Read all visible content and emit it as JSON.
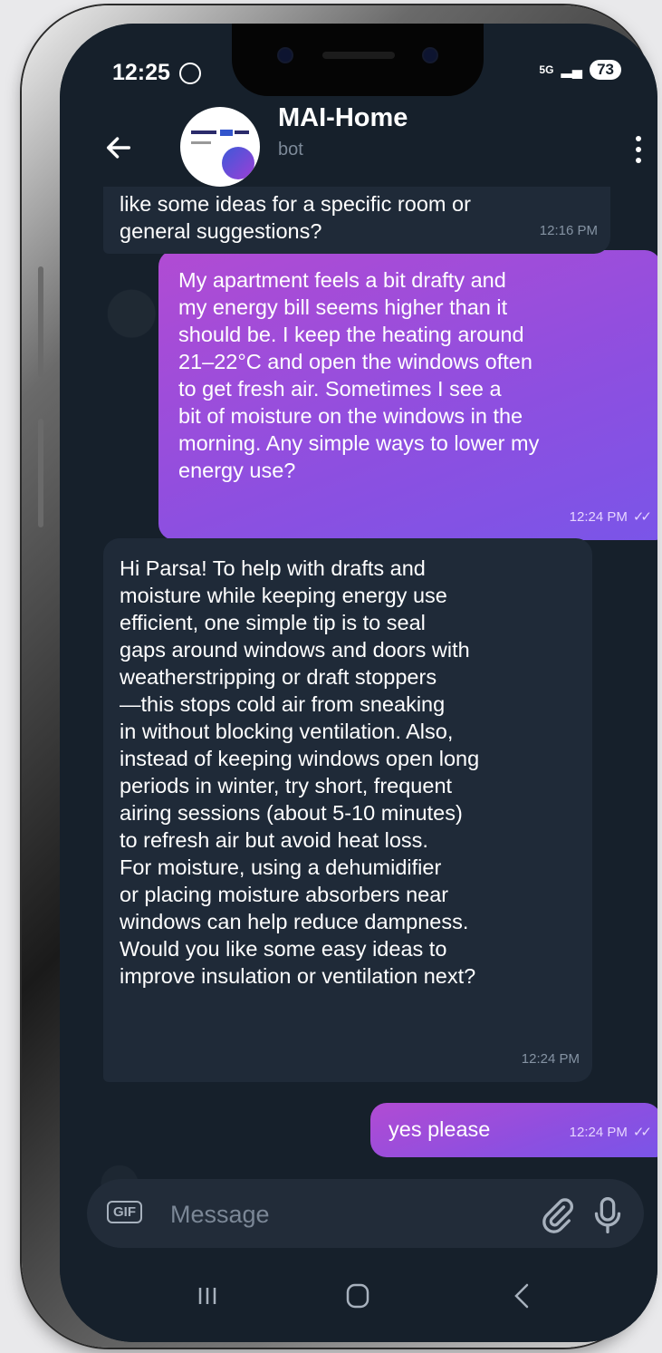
{
  "status": {
    "time": "12:25",
    "network": "5G",
    "battery": "73"
  },
  "header": {
    "title": "MAI-Home",
    "subtitle": "bot"
  },
  "messages": [
    {
      "direction": "in",
      "text": "like some ideas for a specific room or\ngeneral suggestions?",
      "time": "12:16 PM"
    },
    {
      "direction": "out",
      "text": "My apartment feels a bit drafty and\nmy energy bill seems higher than it\nshould be. I keep the heating around\n21–22°C and open the windows often\nto get fresh air. Sometimes I see a\nbit of moisture on the windows in the\nmorning. Any simple ways to lower my\nenergy use?",
      "time": "12:24 PM",
      "read": true
    },
    {
      "direction": "in",
      "text": "Hi Parsa! To help with drafts and\nmoisture while keeping energy use\nefficient, one simple tip is to seal\ngaps around windows and doors with\nweatherstripping or draft stoppers\n—this stops cold air from sneaking\nin without blocking ventilation. Also,\ninstead of keeping windows open long\nperiods in winter, try short, frequent\nairing sessions (about 5-10 minutes)\nto refresh air but avoid heat loss.\nFor moisture, using a dehumidifier\nor placing moisture absorbers near\nwindows can help reduce dampness.\nWould you like some easy ideas to\nimprove insulation or ventilation next?",
      "time": "12:24 PM"
    },
    {
      "direction": "out",
      "text": "yes please",
      "time": "12:24 PM",
      "read": true
    }
  ],
  "composer": {
    "gif_label": "GIF",
    "placeholder": "Message"
  },
  "colors": {
    "background": "#16202b",
    "incoming_bubble": "#1f2a38",
    "outgoing_bubble": "#9b4fdc"
  }
}
